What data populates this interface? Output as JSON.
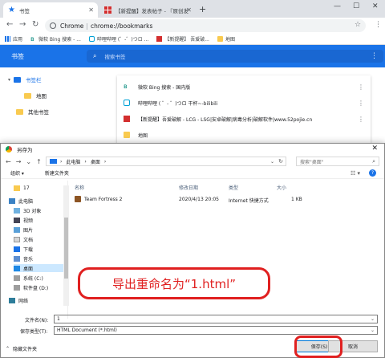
{
  "browser": {
    "tabs": [
      {
        "title": "书签",
        "active": true
      },
      {
        "title": "【新提醒】发表帖子 - 『原创发",
        "active": false
      }
    ],
    "address": {
      "site": "Chrome",
      "url": "chrome://bookmarks"
    },
    "bookmarks_bar": [
      "应用",
      "微软 Bing 搜索 - ...",
      "哔哩哔哩 (゜-゜)つロ ...",
      "【新提醒】 吾爱破...",
      "地图"
    ]
  },
  "bookmarks_page": {
    "title": "书签",
    "search_placeholder": "搜索书签",
    "tree": [
      {
        "label": "书签栏",
        "selected": true
      },
      {
        "label": "地图",
        "selected": false
      },
      {
        "label": "其他书签",
        "selected": false
      }
    ],
    "list": [
      {
        "title": "微软 Bing 搜索 - 国内版",
        "icon": "bing-icon"
      },
      {
        "title": "哔哩哔哩 ( ゜- ゜)つロ 干杯~-bilibili",
        "icon": "bilibili-icon"
      },
      {
        "title": "【新提醒】吾爱破解 - LCG - LSG|安卓破解|病毒分析|破解软件|www.52pojie.cn",
        "icon": "52pojie-icon"
      },
      {
        "title": "地图",
        "icon": "folder-icon"
      }
    ]
  },
  "dialog": {
    "title": "另存为",
    "path": [
      "此电脑",
      "桌面"
    ],
    "search_placeholder": "搜索\"桌面\"",
    "commands": [
      "组织 ▾",
      "新建文件夹"
    ],
    "nav": [
      {
        "label": "17",
        "icon": "ni-folder",
        "selected": false
      },
      {
        "label": "此电脑",
        "icon": "ni-pc",
        "selected": false
      },
      {
        "label": "3D 对象",
        "icon": "ni-3d",
        "selected": false
      },
      {
        "label": "视频",
        "icon": "ni-vid",
        "selected": false
      },
      {
        "label": "图片",
        "icon": "ni-pic",
        "selected": false
      },
      {
        "label": "文档",
        "icon": "ni-doc",
        "selected": false
      },
      {
        "label": "下载",
        "icon": "ni-dl",
        "selected": false
      },
      {
        "label": "音乐",
        "icon": "ni-music",
        "selected": false
      },
      {
        "label": "桌面",
        "icon": "ni-desk",
        "selected": true
      },
      {
        "label": "系统 (C:)",
        "icon": "ni-drive",
        "selected": false
      },
      {
        "label": "软件盘 (D:)",
        "icon": "ni-drive",
        "selected": false
      },
      {
        "label": "网络",
        "icon": "ni-net",
        "selected": false
      }
    ],
    "columns": [
      "名称",
      "修改日期",
      "类型",
      "大小"
    ],
    "files": [
      {
        "name": "Team Fortress 2",
        "date": "2020/4/13 20:05",
        "type": "Internet 快捷方式",
        "size": "1 KB"
      }
    ],
    "annotation": "导出重命名为“1.html”",
    "filename_label": "文件名(N):",
    "filename_value": "1",
    "filetype_label": "保存类型(T):",
    "filetype_value": "HTML Document (*.html)",
    "hide_folders": "隐藏文件夹",
    "save_label": "保存(S)",
    "cancel_label": "取消"
  }
}
